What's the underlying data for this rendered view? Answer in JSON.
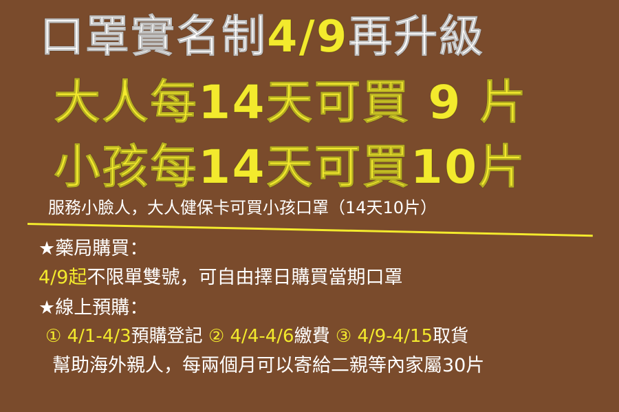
{
  "title": {
    "part1": "口罩實名制",
    "date": "4/9",
    "part2": "再升級"
  },
  "adult_line": "大人每14天可買 9 片",
  "child_line": "小孩每14天可買10片",
  "subtitle": "服務小臉人，大人健保卡可買小孩口罩（14天10片）",
  "pharmacy": {
    "heading": "★藥局購買：",
    "highlight": "4/9起",
    "detail": "不限單雙號，可自由擇日購買當期口罩"
  },
  "online": {
    "heading": "★線上預購：",
    "steps": [
      {
        "mark": "①",
        "dates": "4/1-4/3",
        "action": "預購登記"
      },
      {
        "mark": "②",
        "dates": "4/4-4/6",
        "action": "繳費"
      },
      {
        "mark": "③",
        "dates": "4/9-4/15",
        "action": "取貨"
      }
    ],
    "note": "幫助海外親人，每兩個月可以寄給二親等內家屬30片"
  },
  "colors": {
    "background": "#7a4b2c",
    "white": "#ffffff",
    "yellow": "#f3ea2d"
  }
}
